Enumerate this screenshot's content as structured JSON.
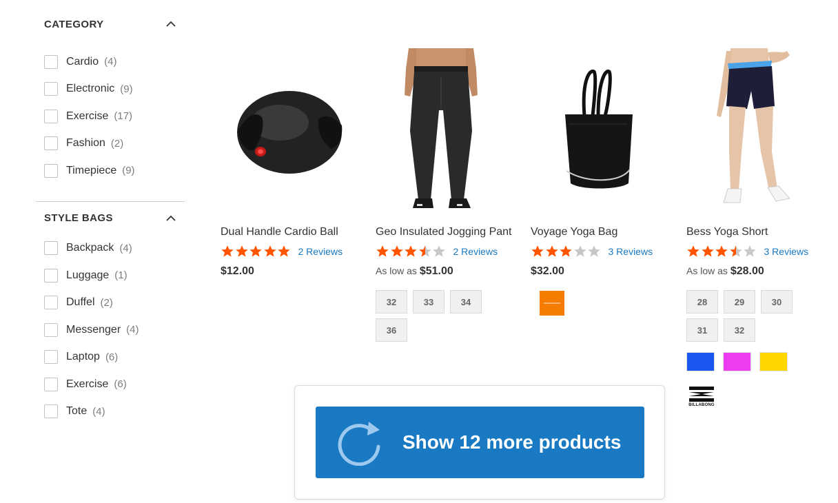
{
  "filters": {
    "category": {
      "title": "CATEGORY",
      "items": [
        {
          "label": "Cardio",
          "count": "(4)"
        },
        {
          "label": "Electronic",
          "count": "(9)"
        },
        {
          "label": "Exercise",
          "count": "(17)"
        },
        {
          "label": "Fashion",
          "count": "(2)"
        },
        {
          "label": "Timepiece",
          "count": "(9)"
        }
      ]
    },
    "style_bags": {
      "title": "STYLE BAGS",
      "items": [
        {
          "label": "Backpack",
          "count": "(4)"
        },
        {
          "label": "Luggage",
          "count": "(1)"
        },
        {
          "label": "Duffel",
          "count": "(2)"
        },
        {
          "label": "Messenger",
          "count": "(4)"
        },
        {
          "label": "Laptop",
          "count": "(6)"
        },
        {
          "label": "Exercise",
          "count": "(6)"
        },
        {
          "label": "Tote",
          "count": "(4)"
        }
      ]
    }
  },
  "products": [
    {
      "name": "Dual Handle Cardio Ball",
      "rating": 5,
      "reviews": "2  Reviews",
      "price": "$12.00",
      "image": "cardio-ball"
    },
    {
      "name": "Geo Insulated Jogging Pant",
      "rating": 3.5,
      "reviews": "2  Reviews",
      "as_low_as": "As low as",
      "price": "$51.00",
      "sizes": [
        "32",
        "33",
        "34",
        "36"
      ],
      "image": "jogging-pant"
    },
    {
      "name": "Voyage Yoga Bag",
      "rating": 3,
      "reviews": "3  Reviews",
      "price": "$32.00",
      "brand_color": "#f57c00",
      "image": "yoga-bag"
    },
    {
      "name": "Bess Yoga Short",
      "rating": 3.5,
      "reviews": "3  Reviews",
      "as_low_as": "As low as",
      "price": "$28.00",
      "sizes": [
        "28",
        "29",
        "30",
        "31",
        "32"
      ],
      "swatches": [
        "#1a56f0",
        "#ee3cf0",
        "#ffd600"
      ],
      "brand_text": "BILLABONG",
      "image": "yoga-short"
    }
  ],
  "load_more": {
    "label": "Show 12 more products",
    "icon": "reload-icon"
  },
  "colors": {
    "star": "#ff5501",
    "star_empty": "#c7c7c7",
    "link": "#1979c3",
    "button": "#1979c3"
  }
}
